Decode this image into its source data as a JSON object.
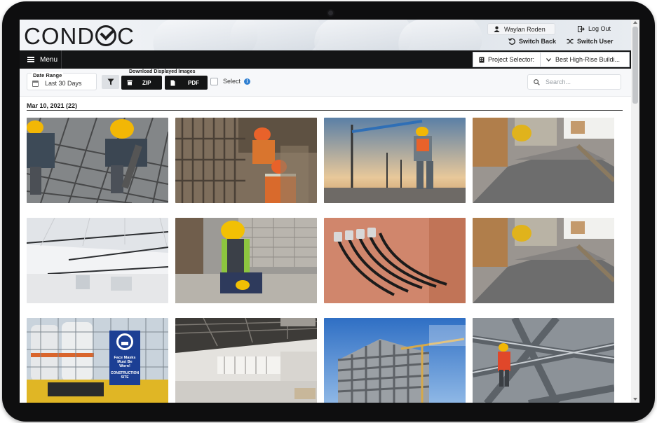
{
  "app": {
    "logo_text_prefix": "COND",
    "logo_text_suffix": "C"
  },
  "header": {
    "user_name": "Waylan Roden",
    "logout_label": "Log Out",
    "switch_back_label": "Switch Back",
    "switch_user_label": "Switch User"
  },
  "nav": {
    "menu_label": "Menu",
    "project_selector_label": "Project Selector:",
    "project_selected": "Best High-Rise Buildi..."
  },
  "toolbar": {
    "date_range_label": "Date Range",
    "date_range_value": "Last 30 Days",
    "download_label": "Download Displayed Images",
    "zip_label": "ZIP",
    "pdf_label": "PDF",
    "select_label": "Select",
    "search_placeholder": "Search..."
  },
  "gallery": {
    "section_title": "Mar 10, 2021 (22)",
    "images": [
      {
        "subject": "rebar-workers"
      },
      {
        "subject": "trench-workers"
      },
      {
        "subject": "crane-site-worker"
      },
      {
        "subject": "concrete-pour"
      },
      {
        "subject": "interior-ceiling"
      },
      {
        "subject": "worker-seated-rubble"
      },
      {
        "subject": "electrical-cables"
      },
      {
        "subject": "concrete-pour"
      },
      {
        "subject": "face-mask-sign"
      },
      {
        "subject": "office-interior"
      },
      {
        "subject": "building-frame-crane"
      },
      {
        "subject": "steel-beams-worker"
      }
    ],
    "sign_text": [
      "Face Masks",
      "Must Be",
      "Worn!",
      "CONSTRUCTION",
      "SITE"
    ]
  },
  "colors": {
    "nav_bg": "#141516",
    "accent_info": "#2f7fd1",
    "hardhat_yellow": "#f2b705",
    "hardhat_orange": "#e8622a",
    "sign_blue": "#1c3f94"
  }
}
